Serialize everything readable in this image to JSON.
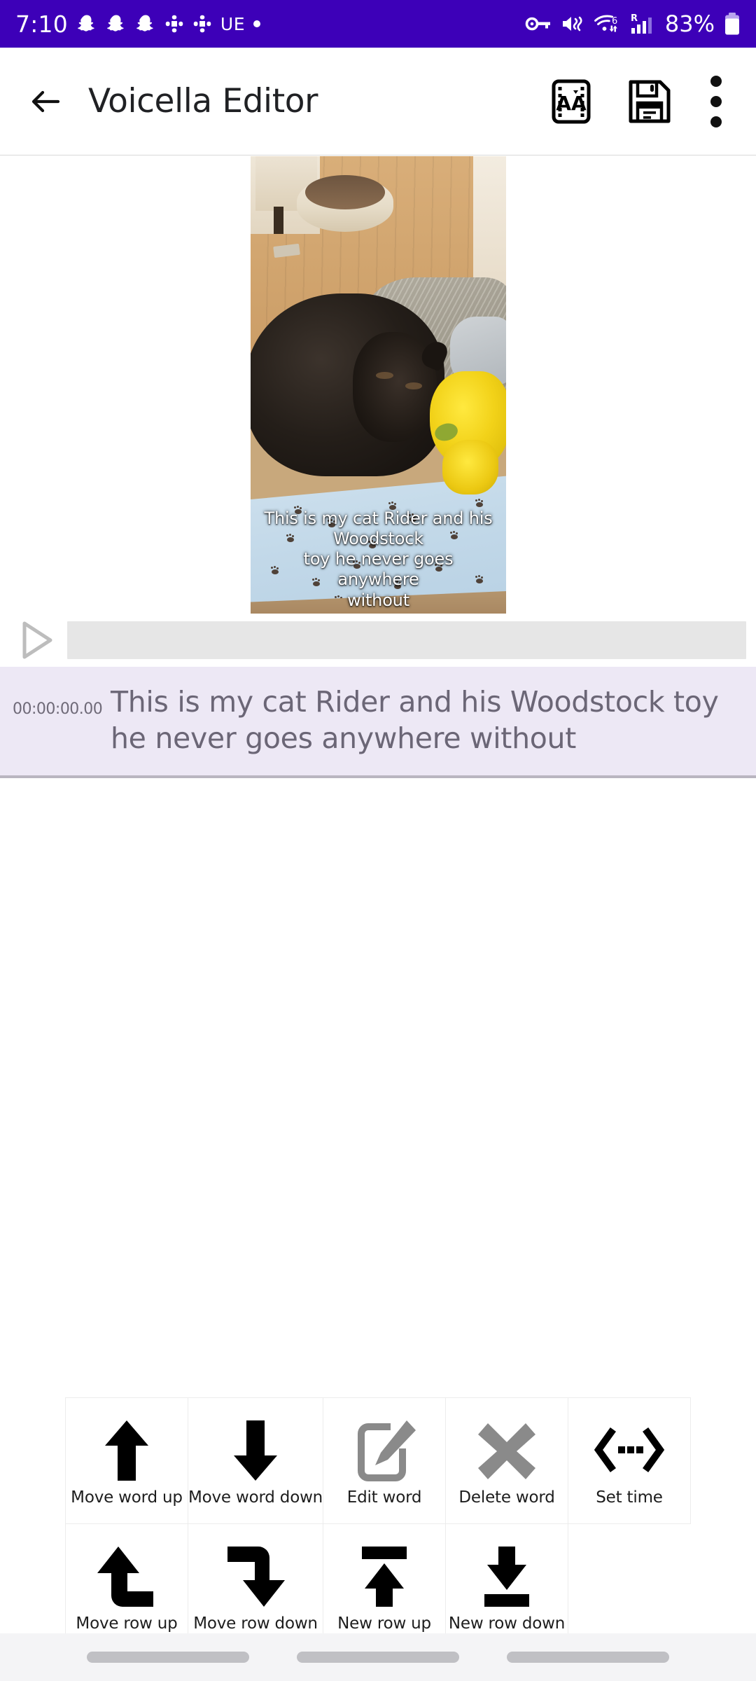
{
  "statusbar": {
    "time": "7:10",
    "battery_percent": "83%",
    "carrier_label": "UE",
    "wifi_generation": "6",
    "roaming_label": "R",
    "icons": [
      "snapchat-icon",
      "snapchat-icon",
      "snapchat-icon",
      "slack-icon",
      "slack-icon",
      "dot-icon",
      "vpn-key-icon",
      "mute-icon",
      "wifi-icon",
      "signal-icon",
      "battery-icon"
    ],
    "background_color": "#3D00B8",
    "foreground_color": "#FFFFFF"
  },
  "appbar": {
    "back_label": "Back",
    "title": "Voicella Editor",
    "actions": [
      {
        "name": "caption-style-button",
        "label": "Caption style"
      },
      {
        "name": "save-button",
        "label": "Save"
      },
      {
        "name": "overflow-menu-button",
        "label": "More options"
      }
    ]
  },
  "preview": {
    "caption_lines": [
      "This is my cat Rider and his",
      "Woodstock",
      "toy he never goes anywhere",
      "without"
    ],
    "alt": "Black cat lying on a blue paw-print blanket next to a yellow plush Woodstock toy"
  },
  "player": {
    "play_label": "Play",
    "progress_percent": 0,
    "seek_label": "Seek bar"
  },
  "transcript": {
    "rows": [
      {
        "time": "00:00:00.00",
        "text": "This is my cat Rider and his Woodstock toy he never goes anywhere without",
        "selected": true
      }
    ]
  },
  "toolbar": {
    "rows": [
      [
        {
          "name": "move-word-up-button",
          "label": "Move word up",
          "icon": "arrow-up-icon",
          "color": "#000000"
        },
        {
          "name": "move-word-down-button",
          "label": "Move word down",
          "icon": "arrow-down-icon",
          "color": "#000000"
        },
        {
          "name": "edit-word-button",
          "label": "Edit word",
          "icon": "edit-pencil-icon",
          "color": "#8a8a8a"
        },
        {
          "name": "delete-word-button",
          "label": "Delete word",
          "icon": "close-x-icon",
          "color": "#8a8a8a"
        },
        {
          "name": "set-time-button",
          "label": "Set time",
          "icon": "set-time-icon",
          "color": "#000000"
        }
      ],
      [
        {
          "name": "move-row-up-button",
          "label": "Move row up",
          "icon": "turn-up-arrow-icon",
          "color": "#000000"
        },
        {
          "name": "move-row-down-button",
          "label": "Move row down",
          "icon": "turn-down-arrow-icon",
          "color": "#000000"
        },
        {
          "name": "new-row-up-button",
          "label": "New row up",
          "icon": "arrow-to-top-icon",
          "color": "#000000"
        },
        {
          "name": "new-row-down-button",
          "label": "New row down",
          "icon": "arrow-to-bottom-icon",
          "color": "#000000"
        },
        {
          "name": "empty-cell",
          "label": "",
          "icon": "",
          "color": ""
        }
      ]
    ]
  },
  "navbar": {
    "items": [
      "recents-pill",
      "home-pill",
      "back-pill"
    ]
  },
  "colors": {
    "status_bar": "#3D00B8",
    "selected_row": "#EDE8F5",
    "transcript_text": "#6B6676",
    "seek_track": "#E6E6E6",
    "nav_pill": "#C0C0C4"
  }
}
